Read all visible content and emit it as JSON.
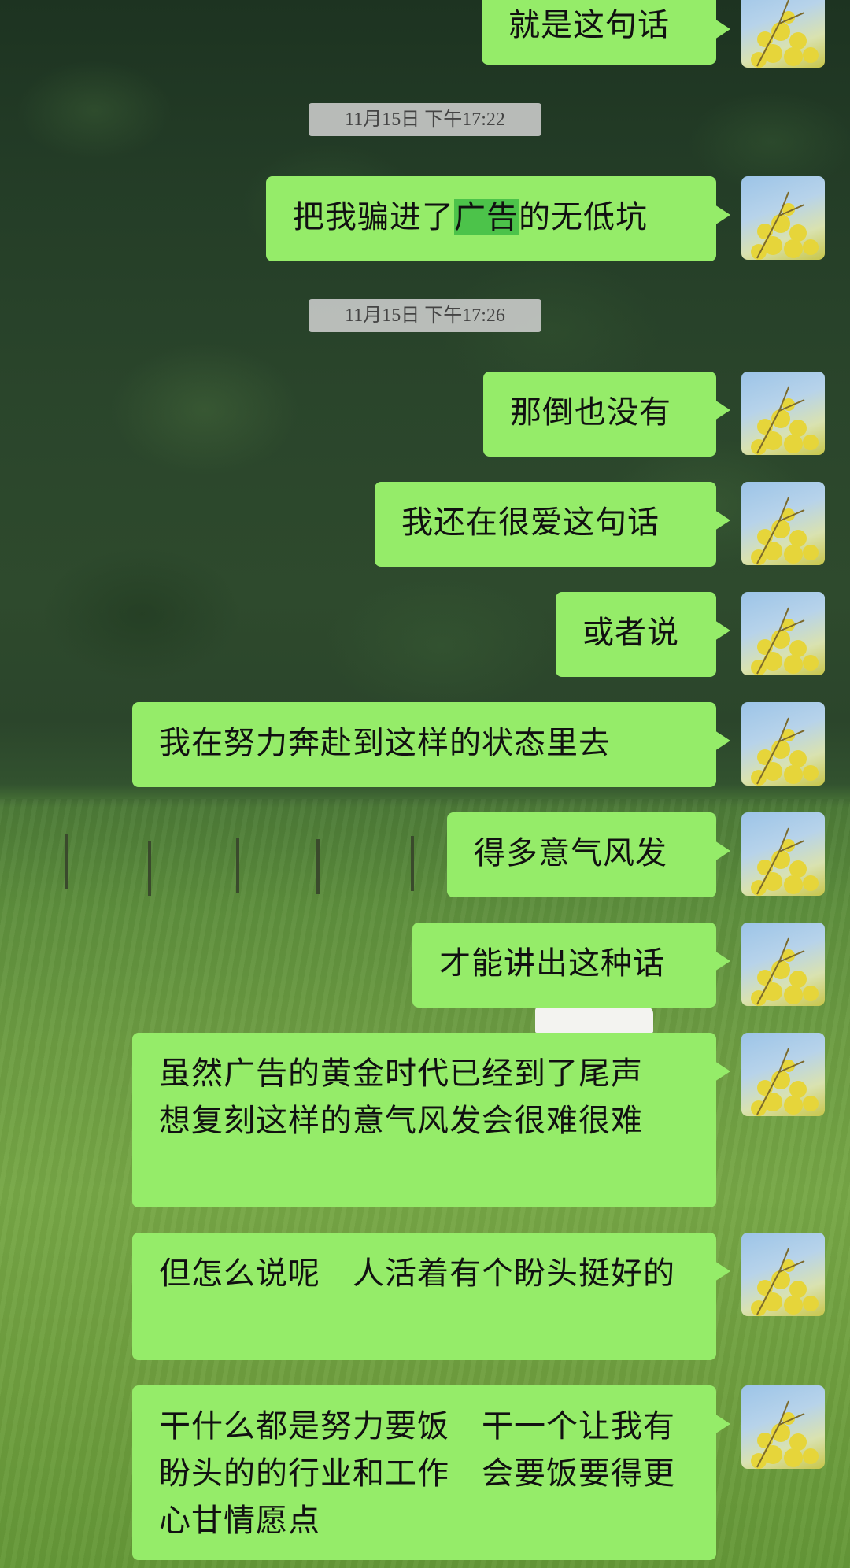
{
  "chat": {
    "timestamps": [
      "11月15日 下午17:22",
      "11月15日 下午17:26"
    ],
    "messages": [
      "就是这句话",
      "把我骗进了",
      "广告",
      "的无低坑",
      "那倒也没有",
      "我还在很爱这句话",
      "或者说",
      "我在努力奔赴到这样的状态里去",
      "得多意气风发",
      "才能讲出这种话",
      "虽然广告的黄金时代已经到了尾声　想复刻这样的意气风发会很难很难",
      "但怎么说呢　人活着有个盼头挺好的",
      "干什么都是努力要饭　干一个让我有盼头的的行业和工作　会要饭要得更心甘情愿点"
    ],
    "bubble_color": "#95ec69",
    "avatar_icon": "yellow-flower-avatar"
  }
}
